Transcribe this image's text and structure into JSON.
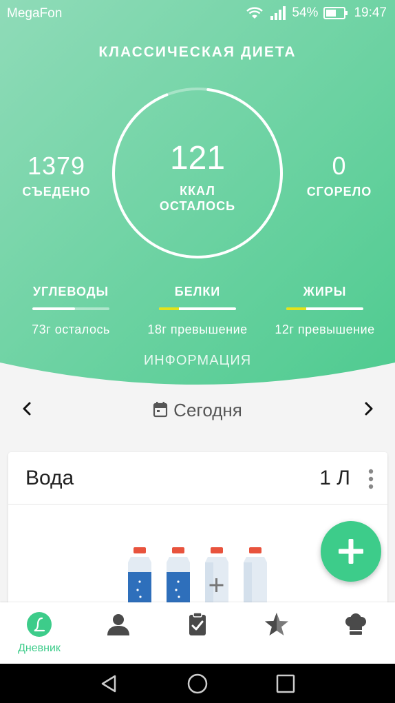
{
  "status_bar": {
    "carrier": "MegaFon",
    "battery": "54%",
    "time": "19:47"
  },
  "header": {
    "title": "КЛАССИЧЕСКАЯ ДИЕТА"
  },
  "summary": {
    "eaten_value": "1379",
    "eaten_label": "СЪЕДЕНО",
    "remaining_value": "121",
    "remaining_label_1": "ККАЛ",
    "remaining_label_2": "ОСТАЛОСЬ",
    "burned_value": "0",
    "burned_label": "СГОРЕЛО",
    "ring_progress_fraction": 0.92
  },
  "macros": [
    {
      "name": "УГЛЕВОДЫ",
      "status": "73г осталось",
      "progress_fraction": 0.55,
      "over": false
    },
    {
      "name": "БЕЛКИ",
      "status": "18г превышение",
      "progress_fraction": 1.0,
      "over": true
    },
    {
      "name": "ЖИРЫ",
      "status": "12г превышение",
      "progress_fraction": 1.0,
      "over": true
    }
  ],
  "info_link": "ИНФОРМАЦИЯ",
  "date_nav": {
    "label": "Сегодня",
    "prev_icon": "chevron-left-icon",
    "next_icon": "chevron-right-icon",
    "calendar_icon": "calendar-icon"
  },
  "water_card": {
    "title": "Вода",
    "amount": "1 Л",
    "bottles": [
      {
        "state": "full"
      },
      {
        "state": "full"
      },
      {
        "state": "add"
      },
      {
        "state": "empty"
      }
    ]
  },
  "fab": {
    "icon": "plus-icon"
  },
  "bottom_nav": {
    "active_label": "Дневник",
    "items": [
      {
        "icon": "diary-icon",
        "label": "Дневник"
      },
      {
        "icon": "profile-icon"
      },
      {
        "icon": "clipboard-check-icon"
      },
      {
        "icon": "star-icon"
      },
      {
        "icon": "chef-hat-icon"
      }
    ]
  },
  "colors": {
    "accent": "#3dcc8a",
    "hero_light": "#86dbb3",
    "hero_dark": "#55cd94",
    "overflow": "#e4e31a",
    "water": "#2e6fbb"
  }
}
